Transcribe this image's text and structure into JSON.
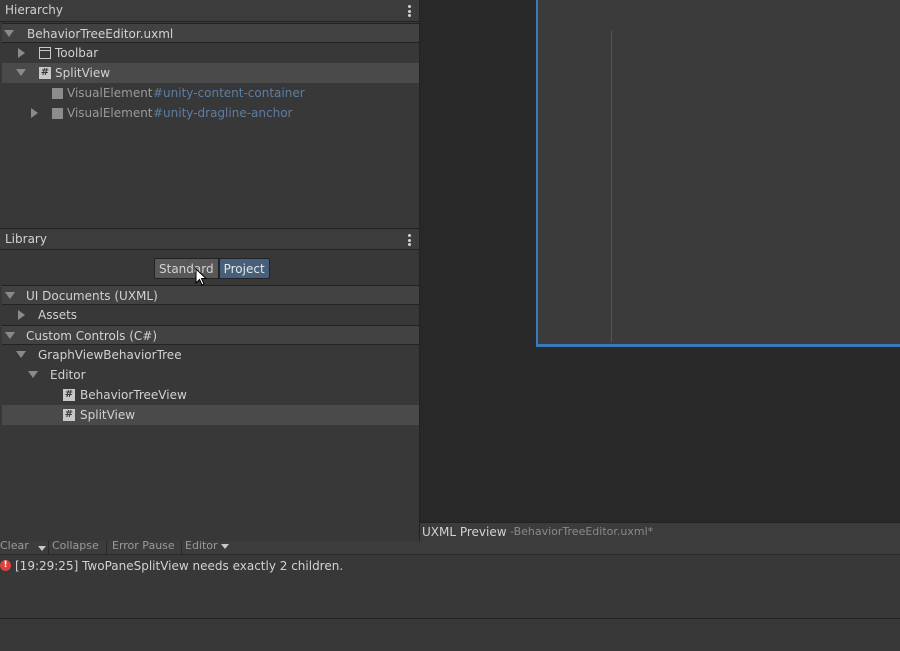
{
  "hierarchy": {
    "title": "Hierarchy",
    "items": [
      {
        "label": "BehaviorTreeEditor.uxml"
      },
      {
        "label": "Toolbar"
      },
      {
        "label": "SplitView"
      },
      {
        "label": "VisualElement",
        "name": "#unity-content-container"
      },
      {
        "label": "VisualElement",
        "name": "#unity-dragline-anchor"
      }
    ]
  },
  "library": {
    "title": "Library",
    "tabs": {
      "standard": "Standard",
      "project": "Project",
      "active": "Project"
    },
    "items": [
      {
        "label": "UI Documents (UXML)"
      },
      {
        "label": "Assets"
      },
      {
        "label": "Custom Controls (C#)"
      },
      {
        "label": "GraphViewBehaviorTree"
      },
      {
        "label": "Editor"
      },
      {
        "label": "BehaviorTreeView"
      },
      {
        "label": "SplitView"
      }
    ]
  },
  "preview": {
    "title": "UXML Preview",
    "subtitle": "-BehaviorTreeEditor.uxml*"
  },
  "console": {
    "toolbar": {
      "clear": "Clear",
      "collapse": "Collapse",
      "error_pause": "Error Pause",
      "editor": "Editor"
    },
    "log": "[19:29:25] TwoPaneSplitView needs exactly 2 children."
  },
  "colors": {
    "accent": "#3a79bb",
    "error": "#e0403a",
    "selector": "#5c7ea3"
  }
}
